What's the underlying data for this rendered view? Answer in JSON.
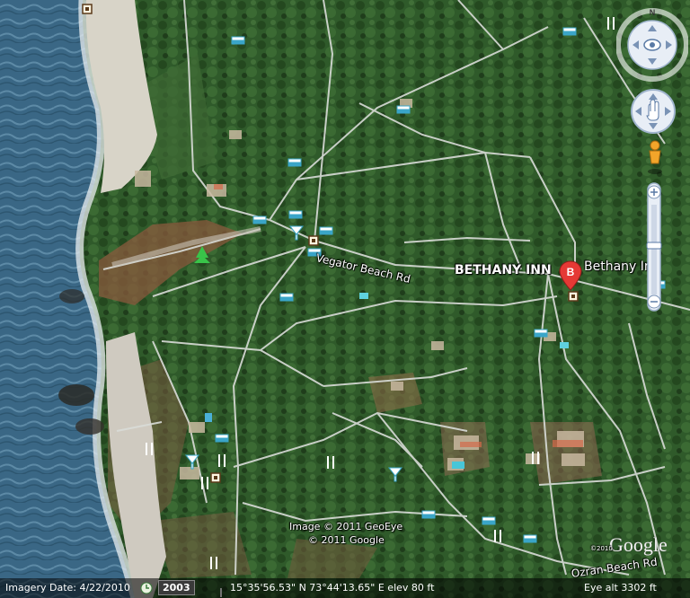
{
  "road_labels": {
    "vagator": "Vegator Beach Rd",
    "ozran": "Ozran Beach Rd"
  },
  "place": {
    "label_large": "BETHANY INN",
    "label_small": "Bethany Inn",
    "marker_letter": "B",
    "marker_color": "#e53935"
  },
  "compass": {
    "north": "N"
  },
  "attribution": {
    "line1": "Image © 2011 GeoEye",
    "line2": "© 2011 Google",
    "logo": "Google",
    "logo_year": "©2010"
  },
  "status_bar": {
    "imagery_date": "Imagery Date: 4/22/2010",
    "year": "2003",
    "coords": "15°35'56.53\" N  73°44'13.65\" E  elev   80 ft",
    "eye_alt": "Eye alt  3302 ft"
  },
  "colors": {
    "sea": "#3f6f8c",
    "beach": "#d8d4c8",
    "vegetation": "#2f5a2a",
    "road": "#d9dcd8",
    "laterite": "#9a5a3c"
  }
}
